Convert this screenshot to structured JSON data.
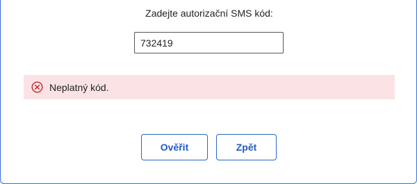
{
  "form": {
    "prompt": "Zadejte autorizační SMS kód:",
    "code_value": "732419"
  },
  "error": {
    "icon": "error-circle-x-icon",
    "message": "Neplatný kód.",
    "color": "#c0262d",
    "background": "#fbe3e5"
  },
  "actions": {
    "verify_label": "Ověřit",
    "back_label": "Zpět",
    "accent": "#1e5bc6"
  }
}
